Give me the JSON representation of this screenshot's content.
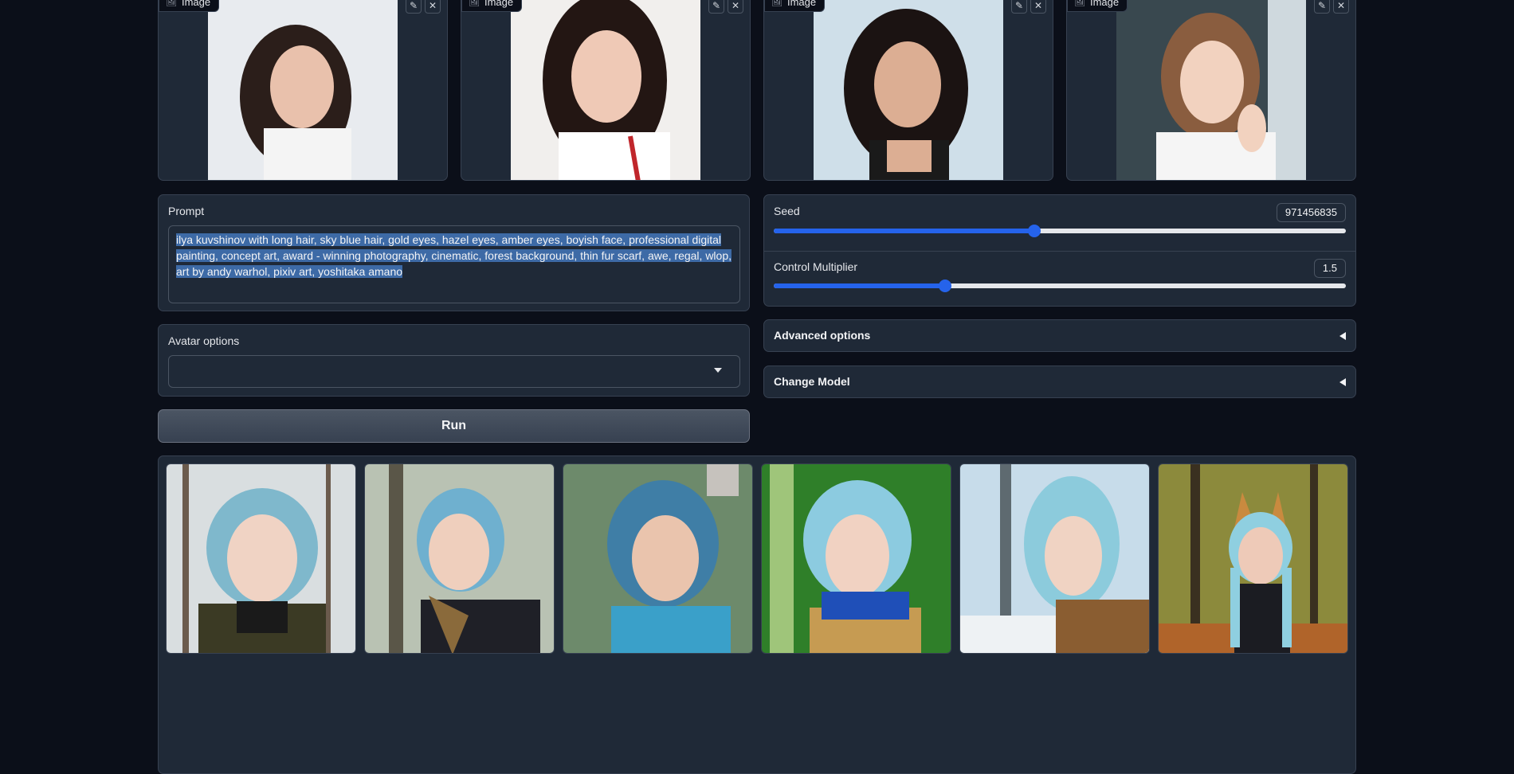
{
  "inputs": [
    {
      "label": "Image",
      "photo_colors": [
        "#e8ebef",
        "#2b1e1a",
        "#e9c1ac"
      ]
    },
    {
      "label": "Image",
      "photo_colors": [
        "#f1efed",
        "#231613",
        "#efc9b6"
      ]
    },
    {
      "label": "Image",
      "photo_colors": [
        "#cfdfe9",
        "#1b1312",
        "#dcae93"
      ]
    },
    {
      "label": "Image",
      "photo_colors": [
        "#39484f",
        "#8a5d3f",
        "#f2d2bf"
      ]
    }
  ],
  "prompt": {
    "label": "Prompt",
    "value": "ilya kuvshinov with long hair, sky blue hair, gold eyes, hazel eyes, amber eyes, boyish face, professional digital painting, concept art, award - winning photography, cinematic, forest background, thin fur scarf, awe, regal, wlop, art by andy warhol, pixiv art, yoshitaka amano"
  },
  "avatar": {
    "label": "Avatar options",
    "value": ""
  },
  "run": {
    "label": "Run"
  },
  "seed": {
    "label": "Seed",
    "value": "971456835",
    "fraction": 0.455
  },
  "control": {
    "label": "Control Multiplier",
    "value": "1.5",
    "fraction": 0.3
  },
  "advanced": {
    "label": "Advanced options"
  },
  "change_model": {
    "label": "Change Model"
  },
  "outputs": [
    {
      "bg": "#d9dee0",
      "hair": "#7fb8cc",
      "skin": "#f0d3c4",
      "coat": "#3b3a24"
    },
    {
      "bg": "#b9c2b3",
      "hair": "#6fb0cf",
      "skin": "#efcfbd",
      "coat": "#1f2027"
    },
    {
      "bg": "#6d8a6b",
      "hair": "#3f7ea6",
      "skin": "#eac4ad",
      "coat": "#3aa0c9"
    },
    {
      "bg": "#2f7f29",
      "hair": "#8ccbe0",
      "skin": "#f1d2c2",
      "coat": "#c69b52"
    },
    {
      "bg": "#c7dcea",
      "hair": "#8ccbdc",
      "skin": "#f0d3c3",
      "coat": "#8a5d31"
    },
    {
      "bg": "#8c8a3c",
      "hair": "#8fcfe0",
      "skin": "#eecab8",
      "coat": "#1b1c22"
    }
  ]
}
